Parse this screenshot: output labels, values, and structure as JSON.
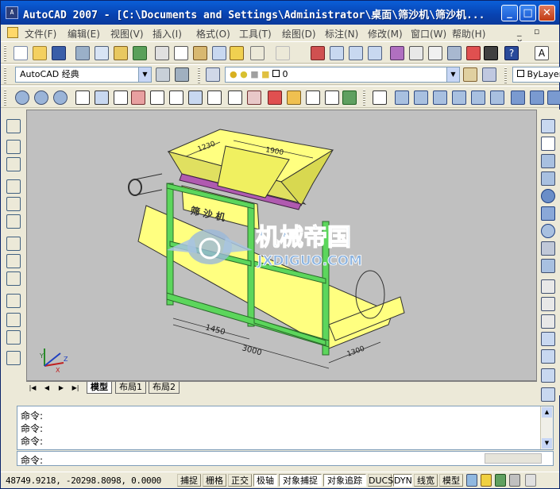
{
  "window": {
    "title": "AutoCAD 2007 - [C:\\Documents and Settings\\Administrator\\桌面\\筛沙机\\筛沙机...",
    "app_icon_text": "A",
    "min_label": "_",
    "max_label": "□",
    "close_label": "✕"
  },
  "menu": [
    "文件(F)",
    "编辑(E)",
    "视图(V)",
    "插入(I)",
    "格式(O)",
    "工具(T)",
    "绘图(D)",
    "标注(N)",
    "修改(M)",
    "窗口(W)",
    "帮助(H)"
  ],
  "doc_controls": "_ ▫ x",
  "toolbar": {
    "workspace": "AutoCAD 经典",
    "layer": "0",
    "color": "ByLayer"
  },
  "drawing": {
    "dim_1230": "1230",
    "dim_1900": "1900",
    "dim_1450": "1450",
    "dim_3000": "3000",
    "dim_1300": "1300",
    "machine_label": "筛 沙 机",
    "watermark_cn": "机械帝国",
    "watermark_en": "JXDIGUO.COM",
    "ucs_y": "Y",
    "ucs_z": "Z",
    "ucs_x": "X"
  },
  "tabs": {
    "model": "模型",
    "layout1": "布局1",
    "layout2": "布局2"
  },
  "command": {
    "history": [
      "命令:",
      "命令:",
      "命令:"
    ],
    "prompt": "命令:"
  },
  "status": {
    "coords": "48749.9218, -20298.8098, 0.0000",
    "buttons": [
      "捕捉",
      "栅格",
      "正交",
      "极轴",
      "对象捕捉",
      "对象追踪",
      "DUCS",
      "DYN",
      "线宽",
      "模型"
    ]
  },
  "colors": {
    "title_blue": "#0a5fd8",
    "canvas": "#c0c0c0",
    "hopper_yellow": "#ffff80",
    "frame_green": "#5cd65c"
  }
}
